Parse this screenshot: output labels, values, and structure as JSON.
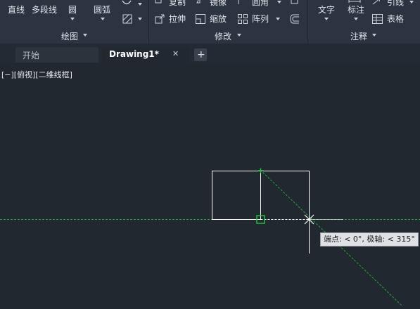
{
  "ribbon": {
    "draw": {
      "line_label": "直线",
      "polyline_label": "多段线",
      "circle_label": "圆",
      "arc_label": "圆弧",
      "panel_title": "绘图"
    },
    "modify": {
      "copy_label": "复制",
      "mirror_label": "镜像",
      "fillet_label": "圆角",
      "stretch_label": "拉伸",
      "scale_label": "缩放",
      "array_label": "阵列",
      "panel_title": "修改"
    },
    "annotation": {
      "text_label": "文字",
      "dimension_label": "标注",
      "leader_label": "引线",
      "table_label": "表格",
      "panel_title": "注释"
    }
  },
  "tabs": {
    "start_label": "开始",
    "drawing_label": "Drawing1*",
    "close_glyph": "✕",
    "new_tab_glyph": "+"
  },
  "viewport": {
    "label": "[−][俯视][二维线框]"
  },
  "tooltip": {
    "text": "端点: < 0°,  极轴: < 315°"
  },
  "colors": {
    "ribbon_bg": "#2d3441",
    "canvas_bg": "#212830",
    "tracking_line": "#1faa34",
    "geometry": "#ffffff",
    "snap_marker": "#1fcc3a"
  },
  "icons": {
    "circle": "circle-icon",
    "arc": "arc-icon",
    "copy": "copy-icon",
    "mirror": "mirror-icon",
    "fillet": "fillet-icon",
    "stretch": "stretch-icon",
    "scale": "scale-icon",
    "array": "array-icon",
    "offset": "offset-icon",
    "leader": "leader-icon",
    "table": "table-icon"
  }
}
